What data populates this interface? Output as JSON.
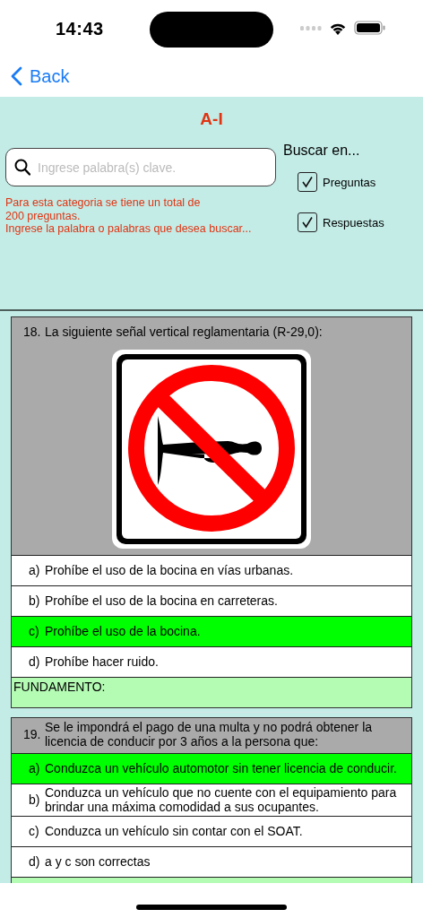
{
  "status_bar": {
    "time": "14:43"
  },
  "nav": {
    "back": "Back"
  },
  "header": {
    "title": "A-I",
    "search": {
      "placeholder": "Ingrese palabra(s) clave."
    },
    "info": "Para esta categoria se tiene un total de\n200 preguntas.\nIngrese la palabra o palabras que desea buscar...",
    "search_in": {
      "label": "Buscar en...",
      "options": [
        {
          "label": "Preguntas",
          "checked": true
        },
        {
          "label": "Respuestas",
          "checked": true
        }
      ]
    }
  },
  "questions": [
    {
      "number": "18.",
      "text": "La siguiente señal vertical reglamentaria (R-29,0):",
      "kind": "image",
      "answers": [
        {
          "letter": "a)",
          "text": "Prohíbe el uso de la bocina en vías urbanas.",
          "correct": false
        },
        {
          "letter": "b)",
          "text": "Prohíbe el uso de la bocina en carreteras.",
          "correct": false
        },
        {
          "letter": "c)",
          "text": "Prohíbe el uso de la bocina.",
          "correct": true
        },
        {
          "letter": "d)",
          "text": "Prohíbe hacer ruido.",
          "correct": false
        }
      ],
      "fundamento": "FUNDAMENTO:"
    },
    {
      "number": "19.",
      "text": "Se le impondrá el pago de una multa y no podrá obtener la licencia de conducir por 3 años a la persona que:",
      "kind": "text",
      "answers": [
        {
          "letter": "a)",
          "text": "Conduzca un vehículo automotor sin tener licencia de conducir.",
          "correct": true
        },
        {
          "letter": "b)",
          "text": "Conduzca un vehículo que no cuente con el equipamiento para brindar una máxima comodidad a sus ocupantes.",
          "correct": false
        },
        {
          "letter": "c)",
          "text": "Conduzca un vehículo sin contar con el SOAT.",
          "correct": false
        },
        {
          "letter": "d)",
          "text": "a y c son correctas",
          "correct": false
        }
      ]
    }
  ]
}
